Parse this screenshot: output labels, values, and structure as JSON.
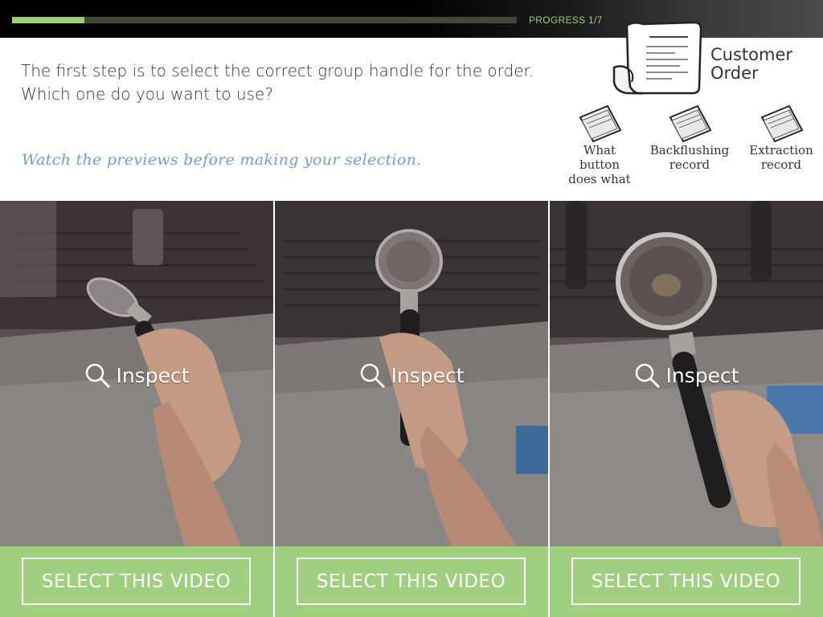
{
  "progress": {
    "label": "PROGRESS 1/7",
    "current": 1,
    "total": 7,
    "fraction": 0.143
  },
  "question": {
    "line1": "The first step is to select the correct group handle for the order.",
    "line2": "Which one do you want to use?"
  },
  "hint": "Watch the previews before making your selection.",
  "customer_order": {
    "line1": "Customer",
    "line2": "Order",
    "icon": "receipt-icon"
  },
  "resources": [
    {
      "label": "What\nbutton\ndoes what",
      "icon": "ticket-icon"
    },
    {
      "label": "Backflushing\nrecord",
      "icon": "ticket-icon"
    },
    {
      "label": "Extraction\nrecord",
      "icon": "ticket-icon"
    }
  ],
  "videos": [
    {
      "inspect_label": "Inspect",
      "select_label": "SELECT THIS VIDEO"
    },
    {
      "inspect_label": "Inspect",
      "select_label": "SELECT THIS VIDEO"
    },
    {
      "inspect_label": "Inspect",
      "select_label": "SELECT THIS VIDEO"
    }
  ],
  "colors": {
    "accent_green": "#9fcf7f",
    "progress_green": "#9bce7d",
    "hint_blue": "#6f9fca"
  }
}
